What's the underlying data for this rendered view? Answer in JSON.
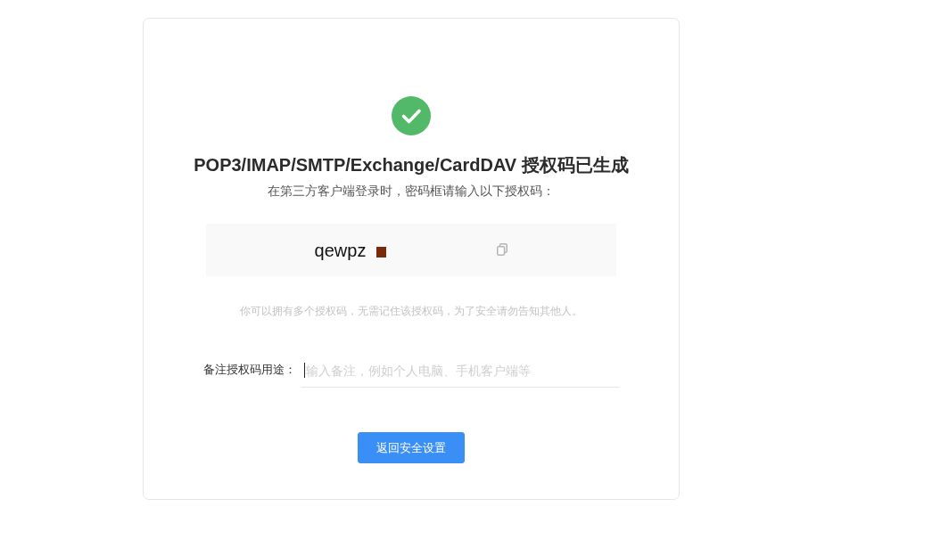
{
  "status": {
    "kind": "success"
  },
  "title": "POP3/IMAP/SMTP/Exchange/CardDAV 授权码已生成",
  "subtitle": "在第三方客户端登录时，密码框请输入以下授权码：",
  "auth_code": {
    "value": "qewpz",
    "redacted": true
  },
  "note": "你可以拥有多个授权码，无需记住该授权码，为了安全请勿告知其他人。",
  "remark": {
    "label": "备注授权码用途：",
    "placeholder": "输入备注，例如个人电脑、手机客户端等",
    "focused": true
  },
  "buttons": [
    {
      "label": "返回安全设置",
      "kind": "primary"
    }
  ]
}
